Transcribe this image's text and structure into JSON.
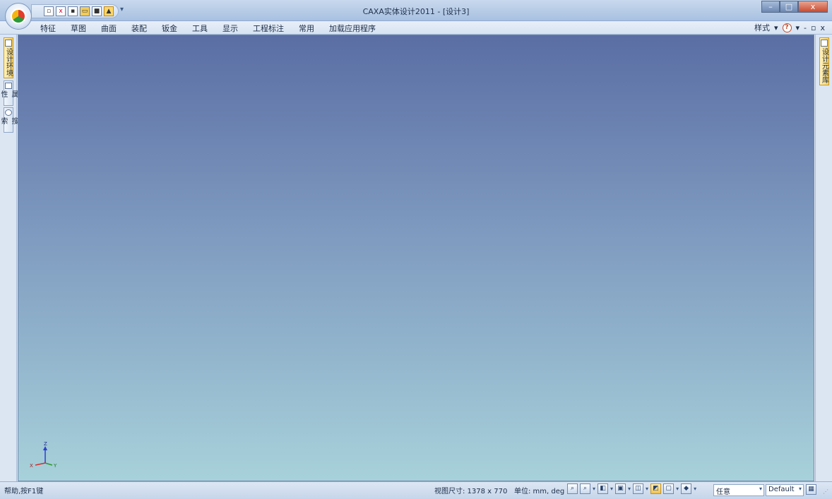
{
  "window": {
    "title": "CAXA实体设计2011 - [设计3]",
    "controls": {
      "minimize": "–",
      "maximize": "□",
      "close": "x"
    }
  },
  "quick_access": {
    "icons": [
      "new-document-icon",
      "close-document-icon",
      "insert-icon",
      "open-folder-icon",
      "save-icon",
      "design-element-icon"
    ],
    "dropdown": "▾"
  },
  "menu": {
    "items": [
      "特征",
      "草图",
      "曲面",
      "装配",
      "钣金",
      "工具",
      "显示",
      "工程标注",
      "常用",
      "加载应用程序"
    ],
    "right": {
      "style_label": "样式",
      "help": "?",
      "dropdown": "▾",
      "minimize": "-",
      "restore": "▫",
      "close": "x"
    }
  },
  "left_panel": {
    "tabs": [
      {
        "label": "设计环境",
        "icon": "design-environment-icon"
      },
      {
        "label": "属性",
        "icon": "properties-icon"
      },
      {
        "label": "搜索",
        "icon": "search-icon"
      }
    ]
  },
  "right_panel": {
    "tabs": [
      {
        "label": "设计元素库",
        "icon": "design-library-icon"
      }
    ]
  },
  "viewport": {
    "axes": {
      "x": "X",
      "y": "Y",
      "z": "Z"
    },
    "colors": {
      "top": "#5a6ea4",
      "bottom": "#a7d1da"
    }
  },
  "status": {
    "help_text": "帮助,按F1键",
    "view_size": "视图尺寸: 1378 x 770",
    "units": "单位: mm, deg",
    "selection_filter": "任意",
    "render_style": "Default"
  }
}
